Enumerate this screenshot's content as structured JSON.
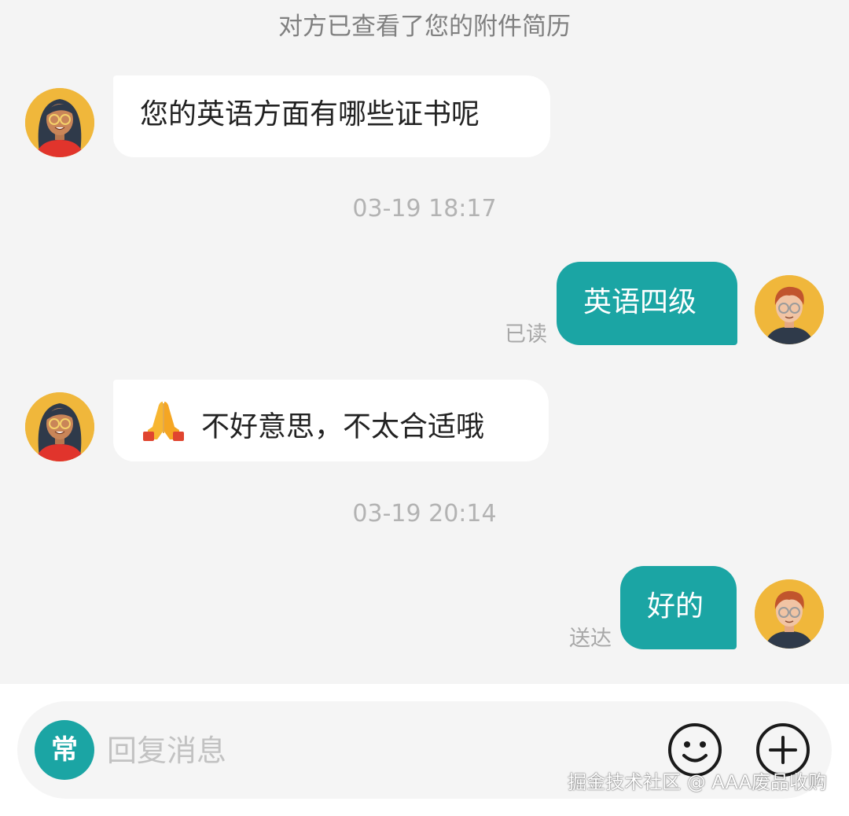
{
  "system_note": "对方已查看了您的附件简历",
  "messages": [
    {
      "side": "in",
      "text": "您的英语方面有哪些证书呢"
    },
    {
      "side": "out",
      "text": "英语四级",
      "status": "已读"
    },
    {
      "side": "in",
      "emoji": "folded-hands",
      "text": "不好意思，不太合适哦"
    },
    {
      "side": "out",
      "text": "好的",
      "status": "送达"
    }
  ],
  "timestamps": [
    "03-19 18:17",
    "03-19 20:14"
  ],
  "composer": {
    "quick_reply_label": "常",
    "placeholder": "回复消息",
    "emoji_button_icon": "smiley-icon",
    "more_button_icon": "plus-circle-icon"
  },
  "watermark": "掘金技术社区 @ AAA废品收购",
  "colors": {
    "accent": "#1ba5a4",
    "incoming_bubble": "#ffffff",
    "background": "#f4f4f4",
    "avatar_bg": "#f0b73b"
  }
}
